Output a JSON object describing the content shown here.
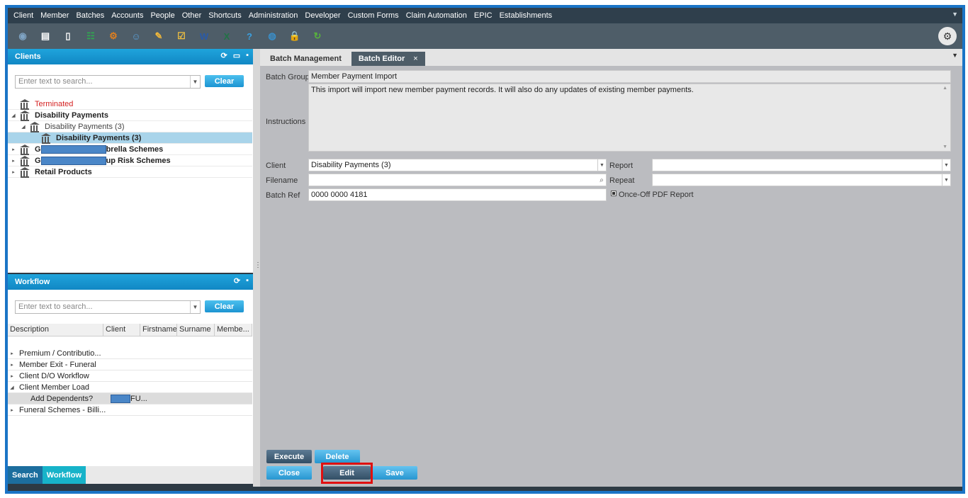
{
  "menubar": {
    "items": [
      "Client",
      "Member",
      "Batches",
      "Accounts",
      "People",
      "Other",
      "Shortcuts",
      "Administration",
      "Developer",
      "Custom Forms",
      "Claim Automation",
      "EPIC",
      "Establishments"
    ],
    "chevron_icon": "chevron-down-icon"
  },
  "toolbar": {
    "icons": [
      "person-icon",
      "id-card-icon",
      "document-icon",
      "org-chart-icon",
      "network-icon",
      "user-settings-icon",
      "note-icon",
      "checklist-icon",
      "word-icon",
      "excel-icon",
      "help-icon",
      "globe-icon",
      "lock-icon",
      "refresh-icon"
    ],
    "glyphs": [
      "◉",
      "▤",
      "▯",
      "☷",
      "⚙",
      "☺",
      "✎",
      "☑",
      "W",
      "X",
      "?",
      "◍",
      "🔒",
      "↻"
    ],
    "colors": [
      "#7fa4c4",
      "#ffffff",
      "#ffffff",
      "#2fa84f",
      "#e07f1f",
      "#5aa0d8",
      "#f0b73a",
      "#f0c040",
      "#2a5aa8",
      "#217346",
      "#3aa0e0",
      "#3a8ec8",
      "#3aa0e0",
      "#58b43c"
    ],
    "settings_icon": "settings-lock-icon"
  },
  "clients_panel": {
    "title": "Clients",
    "search_placeholder": "Enter text to search...",
    "clear_label": "Clear",
    "tree": [
      {
        "label": "Terminated",
        "style": "red",
        "arrow": "",
        "indent": 0
      },
      {
        "label": "Disability Payments",
        "style": "bold",
        "arrow": "◢",
        "indent": 0
      },
      {
        "label": "Disability Payments (3)",
        "style": "normal",
        "arrow": "◢",
        "indent": 1
      },
      {
        "label": "Disability Payments (3)",
        "style": "bold-selected",
        "arrow": "",
        "indent": 2
      },
      {
        "label": "brella Schemes",
        "style": "bold",
        "arrow": "▸",
        "indent": 0,
        "prefix": "G",
        "redacted": true
      },
      {
        "label": "up Risk Schemes",
        "style": "bold",
        "arrow": "▸",
        "indent": 0,
        "prefix": "G",
        "redacted": true
      },
      {
        "label": "Retail Products",
        "style": "bold",
        "arrow": "▸",
        "indent": 0
      }
    ]
  },
  "workflow_panel": {
    "title": "Workflow",
    "search_placeholder": "Enter text to search...",
    "clear_label": "Clear",
    "columns": [
      "Description",
      "Client",
      "Firstname",
      "Surname",
      "Membe..."
    ],
    "rows": [
      {
        "arrow": "▸",
        "description": "Premium / Contributio...",
        "indent": 0
      },
      {
        "arrow": "▸",
        "description": "Member Exit - Funeral",
        "indent": 0
      },
      {
        "arrow": "▸",
        "description": "Client D/O Workflow",
        "indent": 0
      },
      {
        "arrow": "◢",
        "description": "Client Member Load",
        "indent": 0
      },
      {
        "arrow": "",
        "description": "Add Dependents?",
        "indent": 1,
        "client": "FU...",
        "selected": true
      },
      {
        "arrow": "▸",
        "description": "Funeral Schemes - Billi...",
        "indent": 0
      }
    ]
  },
  "bottom_tabs": {
    "search": "Search",
    "workflow": "Workflow"
  },
  "tabs": {
    "batch_management": "Batch Management",
    "batch_editor": "Batch Editor",
    "close": "×"
  },
  "editor": {
    "batch_group_label": "Batch Group",
    "batch_group_value": "Member Payment Import",
    "instructions_label": "Instructions",
    "instructions_value": "This import will import new member payment records.  It will also do any updates of existing member payments.",
    "client_label": "Client",
    "client_value": "Disability Payments (3)",
    "report_label": "Report",
    "report_value": "",
    "filename_label": "Filename",
    "filename_value": "",
    "repeat_label": "Repeat",
    "repeat_value": "",
    "batch_ref_label": "Batch Ref",
    "batch_ref_value": "0000 0000 4181",
    "once_off_label": "Once-Off PDF Report"
  },
  "buttons": {
    "execute": "Execute",
    "delete": "Delete",
    "close": "Close",
    "edit": "Edit",
    "save": "Save"
  },
  "colors": {
    "accent": "#1fa4dc",
    "highlight": "#e01010",
    "terminated": "#d42020",
    "workflow_tab": "#17b3c9",
    "search_tab": "#1c6e9e"
  }
}
